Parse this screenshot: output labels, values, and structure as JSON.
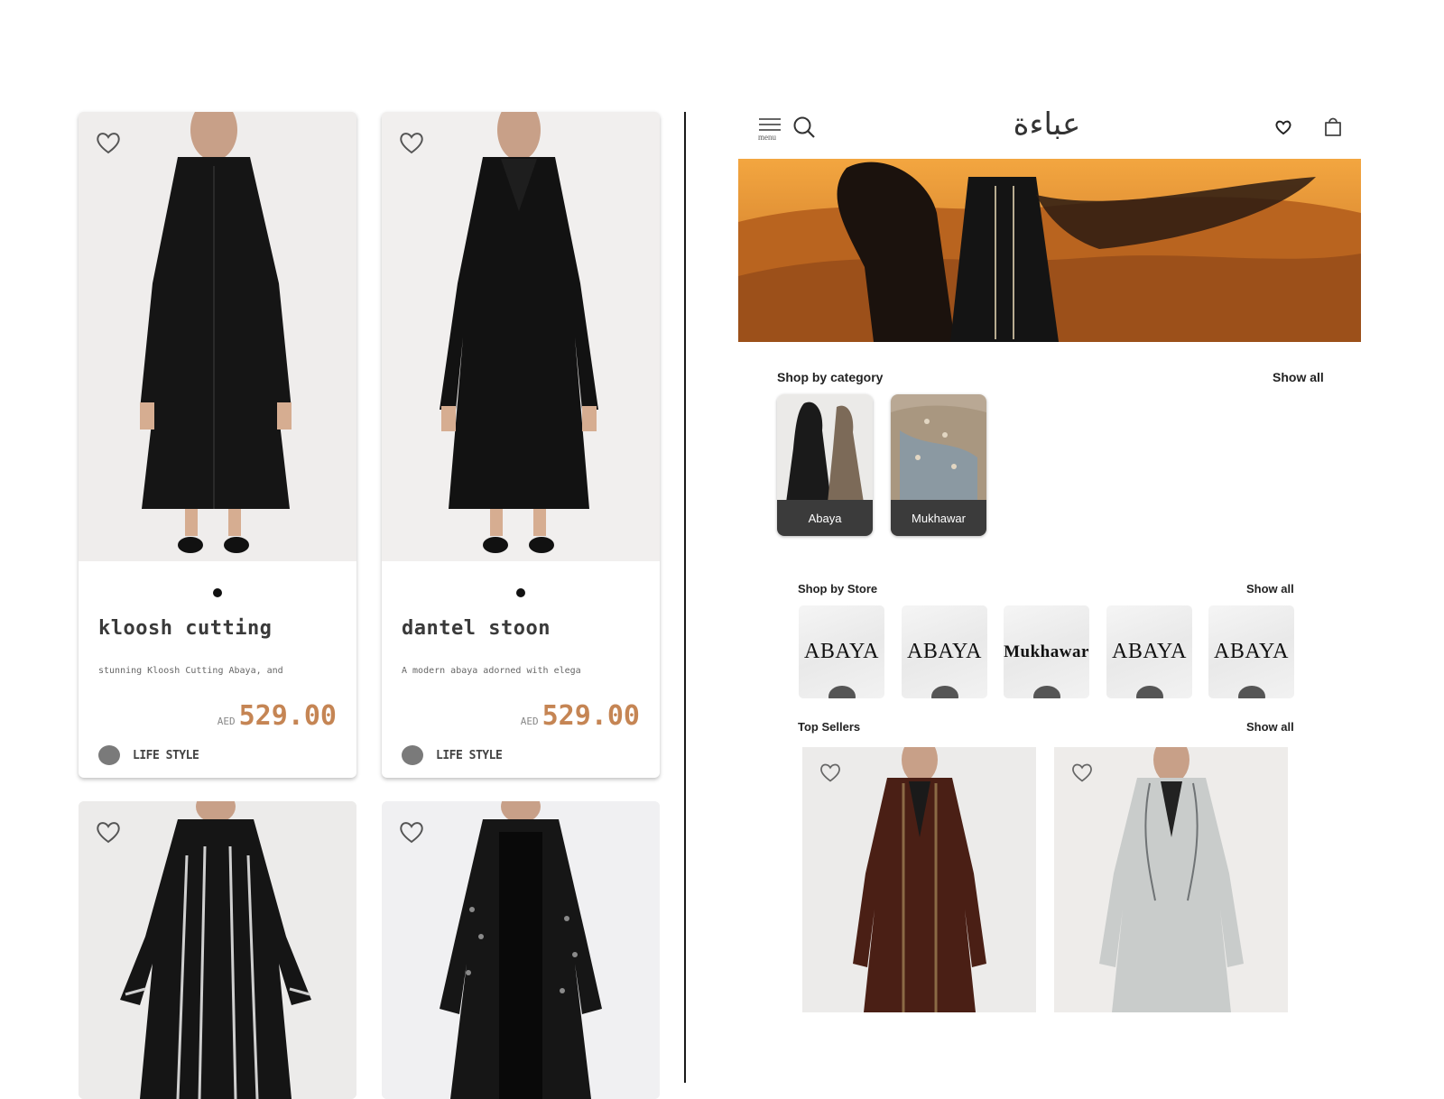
{
  "left_grid": {
    "products": [
      {
        "name": "kloosh cutting",
        "description": "stunning Kloosh Cutting Abaya, and",
        "currency": "AED",
        "price": "529.00",
        "store": "LIFE STYLE",
        "dress_color": "#141414"
      },
      {
        "name": "dantel stoon",
        "description": "A modern abaya adorned with elega",
        "currency": "AED",
        "price": "529.00",
        "store": "LIFE STYLE",
        "dress_color": "#101010"
      }
    ]
  },
  "header": {
    "menu_label": "menu",
    "logo_text": "عباءة"
  },
  "categories": {
    "title": "Shop by category",
    "show_all": "Show all",
    "items": [
      {
        "label": "Abaya"
      },
      {
        "label": "Mukhawar"
      }
    ]
  },
  "stores": {
    "title": "Shop by Store",
    "show_all": "Show all",
    "items": [
      {
        "label": "ABAYA"
      },
      {
        "label": "ABAYA"
      },
      {
        "label": "Mukhawar"
      },
      {
        "label": "ABAYA"
      },
      {
        "label": "ABAYA"
      }
    ]
  },
  "top_sellers": {
    "title": "Top Sellers",
    "show_all": "Show all",
    "items": [
      {
        "dress_color": "#4a1f15"
      },
      {
        "dress_color": "#c9cccb"
      }
    ]
  },
  "colors": {
    "price": "#c58554",
    "label_bg": "#3b3b3b",
    "hero_sky": "#e08a2a"
  }
}
